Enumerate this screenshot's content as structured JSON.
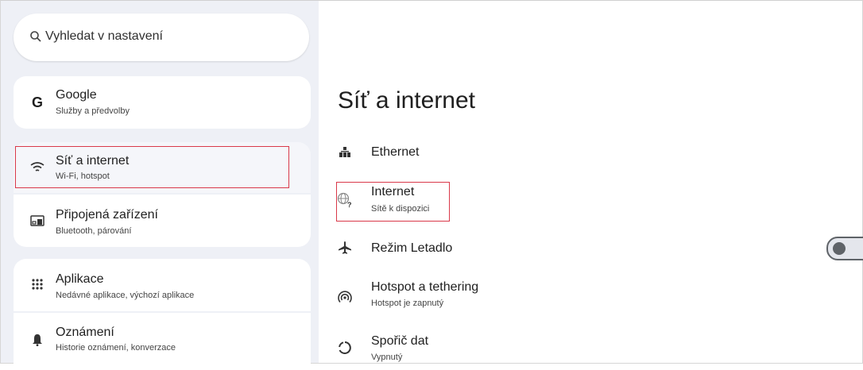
{
  "search": {
    "placeholder": "Vyhledat v nastavení"
  },
  "sidebar": {
    "items": [
      {
        "label": "Google",
        "sub": "Služby a předvolby",
        "icon": "google-g-icon"
      },
      {
        "label": "Síť a internet",
        "sub": "Wi-Fi, hotspot",
        "icon": "wifi-icon"
      },
      {
        "label": "Připojená zařízení",
        "sub": "Bluetooth, párování",
        "icon": "connected-devices-icon"
      },
      {
        "label": "Aplikace",
        "sub": "Nedávné aplikace, výchozí aplikace",
        "icon": "apps-grid-icon"
      },
      {
        "label": "Oznámení",
        "sub": "Historie oznámení, konverzace",
        "icon": "bell-icon"
      }
    ]
  },
  "main": {
    "title": "Síť a internet",
    "items": [
      {
        "label": "Ethernet",
        "icon": "ethernet-icon"
      },
      {
        "label": "Internet",
        "sub": "Sítě k dispozici",
        "icon": "globe-question-icon"
      },
      {
        "label": "Režim Letadlo",
        "icon": "airplane-icon",
        "toggle": "off"
      },
      {
        "label": "Hotspot a tethering",
        "sub": "Hotspot je zapnutý",
        "icon": "hotspot-icon"
      },
      {
        "label": "Spořič dat",
        "sub": "Vypnutý",
        "icon": "data-saver-icon"
      }
    ]
  },
  "colors": {
    "sidebar_bg": "#eef0f6",
    "highlight": "#d9394a",
    "card": "#ffffff"
  }
}
